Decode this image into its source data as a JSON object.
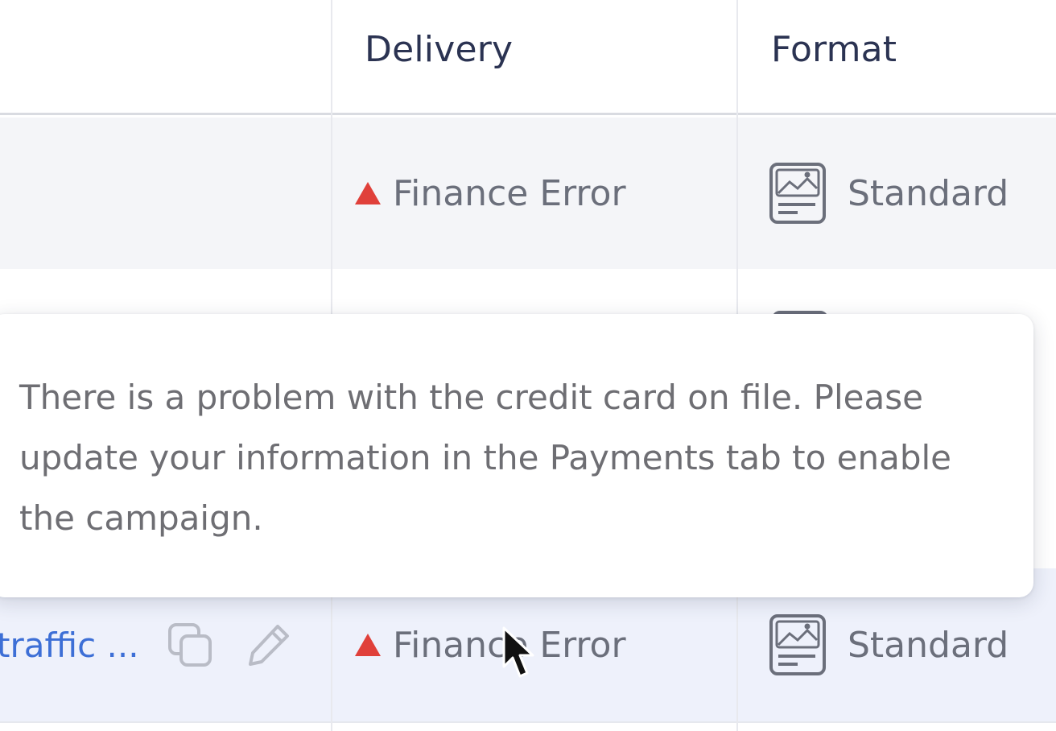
{
  "table": {
    "columns": {
      "delivery": "Delivery",
      "format": "Format"
    },
    "rows": [
      {
        "delivery_status": "Finance Error",
        "format": "Standard"
      },
      {
        "campaign_name": "traffic ...",
        "delivery_status": "Finance Error",
        "format": "Standard"
      }
    ]
  },
  "tooltip": {
    "text": "There is a problem with the credit card on file. Please update your information in the Payments tab to enable the campaign."
  },
  "icons": {
    "status": "warning-triangle-icon",
    "format": "image-ad-format-icon",
    "duplicate": "duplicate-icon",
    "edit": "pencil-edit-icon"
  },
  "colors": {
    "error": "#e0403a",
    "link": "#3d6fd6",
    "header_text": "#2b3352",
    "body_text": "#6b6f7b",
    "row_alt": "#f4f5f8",
    "row_hover": "#eef1fb"
  }
}
